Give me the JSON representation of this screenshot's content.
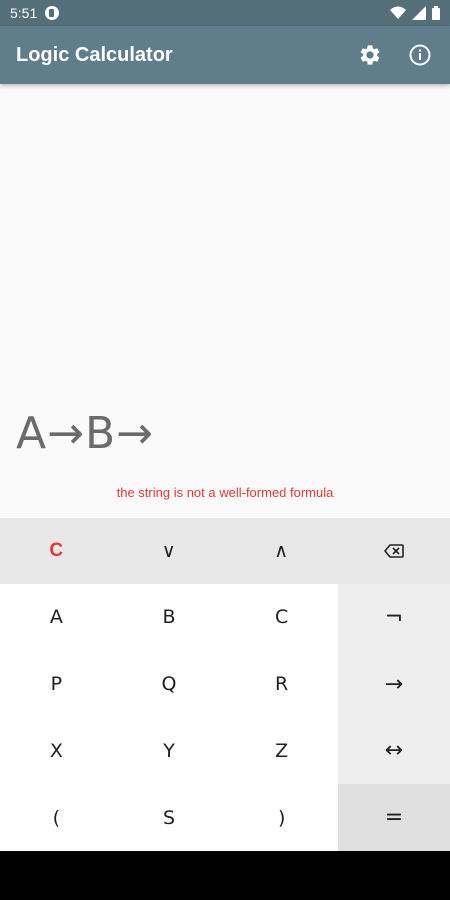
{
  "status_bar": {
    "time": "5:51",
    "icons": [
      "notification-icon",
      "wifi-icon",
      "signal-icon",
      "battery-icon"
    ]
  },
  "app_bar": {
    "title": "Logic Calculator",
    "actions": [
      "settings-icon",
      "info-icon"
    ],
    "color": "#607d8b"
  },
  "display": {
    "formula": "A→B→",
    "error": "the string is not a well-formed formula",
    "error_color": "#e53935"
  },
  "keypad": {
    "top_row": [
      "C",
      "∨",
      "∧",
      "backspace"
    ],
    "letters": [
      "A",
      "B",
      "C",
      "P",
      "Q",
      "R",
      "X",
      "Y",
      "Z",
      "(",
      "S",
      ")"
    ],
    "operators": [
      "¬",
      "→",
      "↔",
      "="
    ]
  }
}
